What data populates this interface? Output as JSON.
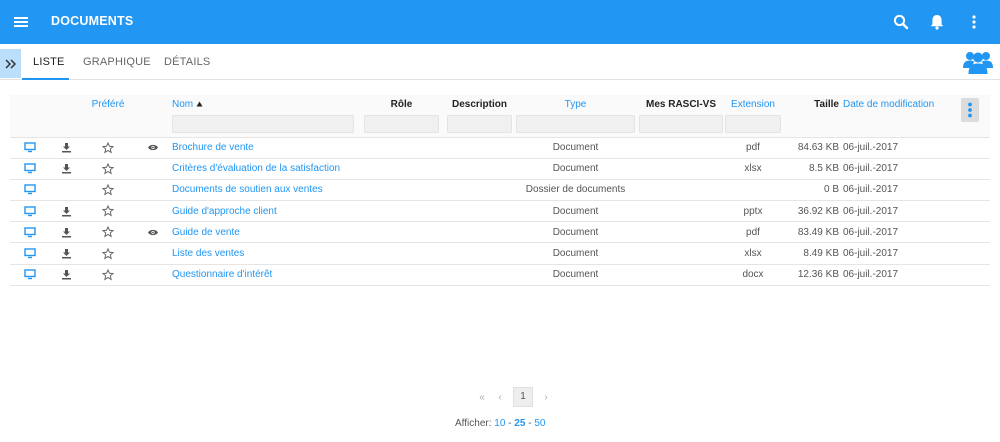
{
  "header": {
    "title": "DOCUMENTS"
  },
  "tabs": [
    {
      "label": "LISTE",
      "active": true
    },
    {
      "label": "GRAPHIQUE",
      "active": false
    },
    {
      "label": "DÉTAILS",
      "active": false
    }
  ],
  "columns": {
    "favorite": "Préféré",
    "name": "Nom",
    "role": "Rôle",
    "description": "Description",
    "type": "Type",
    "rasci": "Mes RASCI-VS",
    "extension": "Extension",
    "size": "Taille",
    "modified": "Date de modification"
  },
  "rows": [
    {
      "name": "Brochure de vente",
      "type": "Document",
      "extension": "pdf",
      "size": "84.63 KB",
      "modified": "06-juil.-2017",
      "download": true,
      "preview": true
    },
    {
      "name": "Critères d'évaluation de la satisfaction",
      "type": "Document",
      "extension": "xlsx",
      "size": "8.5 KB",
      "modified": "06-juil.-2017",
      "download": true,
      "preview": false
    },
    {
      "name": "Documents de soutien aux ventes",
      "type": "Dossier de documents",
      "extension": "",
      "size": "0 B",
      "modified": "06-juil.-2017",
      "download": false,
      "preview": false
    },
    {
      "name": "Guide d'approche client",
      "type": "Document",
      "extension": "pptx",
      "size": "36.92 KB",
      "modified": "06-juil.-2017",
      "download": true,
      "preview": false
    },
    {
      "name": "Guide de vente",
      "type": "Document",
      "extension": "pdf",
      "size": "83.49 KB",
      "modified": "06-juil.-2017",
      "download": true,
      "preview": true
    },
    {
      "name": "Liste des ventes",
      "type": "Document",
      "extension": "xlsx",
      "size": "8.49 KB",
      "modified": "06-juil.-2017",
      "download": true,
      "preview": false
    },
    {
      "name": "Questionnaire d'intérêt",
      "type": "Document",
      "extension": "docx",
      "size": "12.36 KB",
      "modified": "06-juil.-2017",
      "download": true,
      "preview": false
    }
  ],
  "pagination": {
    "first": "«",
    "prev": "‹",
    "current": "1",
    "next": "›",
    "show_label": "Afficher:",
    "sizes": [
      "10",
      "25",
      "50"
    ],
    "separator": " - "
  },
  "colors": {
    "primary": "#2196f3",
    "expander": "#bbdefb"
  }
}
